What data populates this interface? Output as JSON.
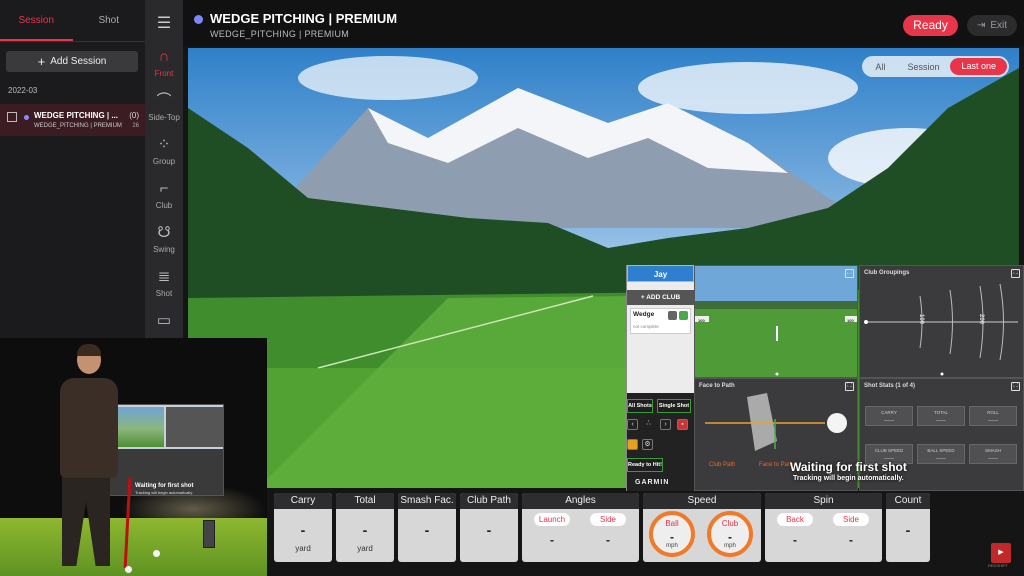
{
  "left_panel": {
    "tabs": [
      "Session",
      "Shot"
    ],
    "add_session": "Add Session",
    "date_group": "2022-03",
    "session": {
      "title": "WEDGE PITCHING | ...",
      "subtitle": "WEDGE_PITCHING | PREMIUM",
      "count": "(0)",
      "number": "26"
    }
  },
  "nav": {
    "items": [
      {
        "label": "Front",
        "icon": "front-trajectory-icon",
        "active": true
      },
      {
        "label": "Side-Top",
        "icon": "side-top-icon",
        "active": false
      },
      {
        "label": "Group",
        "icon": "group-icon",
        "active": false
      },
      {
        "label": "Club",
        "icon": "club-icon",
        "active": false
      },
      {
        "label": "Swing",
        "icon": "swing-icon",
        "active": false
      },
      {
        "label": "Shot",
        "icon": "shot-list-icon",
        "active": false
      }
    ]
  },
  "header": {
    "title": "WEDGE PITCHING | PREMIUM",
    "subtitle": "WEDGE_PITCHING | PREMIUM",
    "ready": "Ready",
    "exit": "Exit"
  },
  "filter": {
    "options": [
      "All",
      "Session",
      "Last one"
    ],
    "selected": "Last one"
  },
  "garmin": {
    "user": "Jay",
    "add_club": "+ ADD CLUB",
    "club_name": "Wedge",
    "club_status": "not complete",
    "all_shots": "All Shots",
    "single_shot": "Single Shot",
    "ready_to_hit": "Ready to Hit!",
    "brand": "GARMIN"
  },
  "panels": {
    "club_groupings": "Club Groupings",
    "face_to_path": "Face to Path",
    "face_to_path_labels": [
      "Club Path",
      "Face to Path"
    ],
    "shot_stats": "Shot Stats (1 of 4)",
    "stats": [
      {
        "label": "CARRY",
        "value": "-----"
      },
      {
        "label": "TOTAL",
        "value": "-----"
      },
      {
        "label": "ROLL",
        "value": "-----"
      },
      {
        "label": "CLUB SPEED",
        "value": "-----"
      },
      {
        "label": "BALL SPEED",
        "value": "-----"
      },
      {
        "label": "SMASH",
        "value": "-----"
      }
    ],
    "scale_labels": [
      "100",
      "200"
    ],
    "range_markers": [
      "100",
      "100"
    ]
  },
  "waiting": {
    "title": "Waiting for first shot",
    "subtitle": "Tracking will begin automatically."
  },
  "data_bar": {
    "carry": {
      "label": "Carry",
      "value": "-",
      "unit": "yard"
    },
    "total": {
      "label": "Total",
      "value": "-",
      "unit": "yard"
    },
    "smash": {
      "label": "Smash Fac.",
      "value": "-"
    },
    "club_path": {
      "label": "Club Path",
      "value": "-"
    },
    "angles": {
      "label": "Angles",
      "launch": "Launch",
      "side": "Side",
      "launch_value": "-",
      "side_value": "-"
    },
    "speed": {
      "label": "Speed",
      "ball": "Ball",
      "club": "Club",
      "ball_value": "-",
      "club_value": "-",
      "unit": "mph"
    },
    "spin": {
      "label": "Spin",
      "back": "Back",
      "side": "Side",
      "back_value": "-",
      "side_value": "-"
    },
    "count": {
      "label": "Count",
      "value": "-"
    }
  },
  "brand_logo_text": "REDSHIFT",
  "colors": {
    "accent": "#e8354a",
    "status_dot": "#7e86ff",
    "garmin_blue": "#2f7fd1",
    "speed_ring": "#f07a2a"
  }
}
